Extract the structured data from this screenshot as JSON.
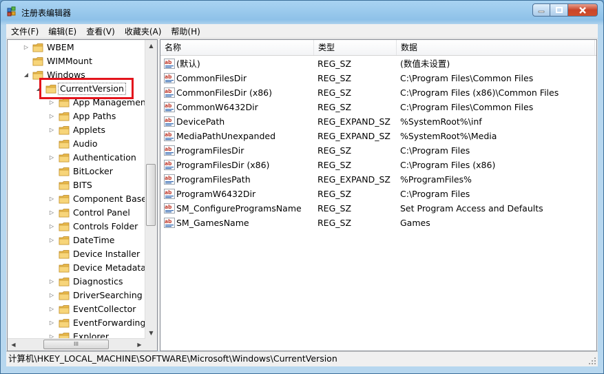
{
  "window": {
    "title": "注册表编辑器",
    "icon": "regedit-icon",
    "controls": {
      "minimize": "minimize-icon",
      "maximize": "maximize-icon",
      "close": "close-icon"
    }
  },
  "menu": [
    "文件(F)",
    "编辑(E)",
    "查看(V)",
    "收藏夹(A)",
    "帮助(H)"
  ],
  "tree": {
    "parents": [
      {
        "label": "WBEM",
        "expander": "collapsed"
      },
      {
        "label": "WIMMount",
        "expander": "none"
      },
      {
        "label": "Windows",
        "expander": "expanded"
      }
    ],
    "selected": {
      "label": "CurrentVersion",
      "expander": "expanded"
    },
    "children": [
      {
        "label": "App Management",
        "expander": "collapsed"
      },
      {
        "label": "App Paths",
        "expander": "collapsed"
      },
      {
        "label": "Applets",
        "expander": "collapsed"
      },
      {
        "label": "Audio",
        "expander": "none"
      },
      {
        "label": "Authentication",
        "expander": "collapsed"
      },
      {
        "label": "BitLocker",
        "expander": "none"
      },
      {
        "label": "BITS",
        "expander": "none"
      },
      {
        "label": "Component Based Servicing",
        "expander": "collapsed"
      },
      {
        "label": "Control Panel",
        "expander": "collapsed"
      },
      {
        "label": "Controls Folder",
        "expander": "collapsed"
      },
      {
        "label": "DateTime",
        "expander": "collapsed"
      },
      {
        "label": "Device Installer",
        "expander": "none"
      },
      {
        "label": "Device Metadata",
        "expander": "none"
      },
      {
        "label": "Diagnostics",
        "expander": "collapsed"
      },
      {
        "label": "DriverSearching",
        "expander": "collapsed"
      },
      {
        "label": "EventCollector",
        "expander": "collapsed"
      },
      {
        "label": "EventForwarding",
        "expander": "collapsed"
      },
      {
        "label": "Explorer",
        "expander": "collapsed"
      }
    ],
    "hscroll_grip": "III"
  },
  "list": {
    "columns": {
      "name": "名称",
      "type": "类型",
      "data": "数据"
    },
    "rows": [
      {
        "name": "(默认)",
        "type": "REG_SZ",
        "data": "(数值未设置)"
      },
      {
        "name": "CommonFilesDir",
        "type": "REG_SZ",
        "data": "C:\\Program Files\\Common Files"
      },
      {
        "name": "CommonFilesDir (x86)",
        "type": "REG_SZ",
        "data": "C:\\Program Files (x86)\\Common Files"
      },
      {
        "name": "CommonW6432Dir",
        "type": "REG_SZ",
        "data": "C:\\Program Files\\Common Files"
      },
      {
        "name": "DevicePath",
        "type": "REG_EXPAND_SZ",
        "data": "%SystemRoot%\\inf"
      },
      {
        "name": "MediaPathUnexpanded",
        "type": "REG_EXPAND_SZ",
        "data": "%SystemRoot%\\Media"
      },
      {
        "name": "ProgramFilesDir",
        "type": "REG_SZ",
        "data": "C:\\Program Files"
      },
      {
        "name": "ProgramFilesDir (x86)",
        "type": "REG_SZ",
        "data": "C:\\Program Files (x86)"
      },
      {
        "name": "ProgramFilesPath",
        "type": "REG_EXPAND_SZ",
        "data": "%ProgramFiles%"
      },
      {
        "name": "ProgramW6432Dir",
        "type": "REG_SZ",
        "data": "C:\\Program Files"
      },
      {
        "name": "SM_ConfigureProgramsName",
        "type": "REG_SZ",
        "data": "Set Program Access and Defaults"
      },
      {
        "name": "SM_GamesName",
        "type": "REG_SZ",
        "data": "Games"
      }
    ]
  },
  "status": {
    "path": "计算机\\HKEY_LOCAL_MACHINE\\SOFTWARE\\Microsoft\\Windows\\CurrentVersion"
  },
  "colors": {
    "highlight_box": "#e3141c",
    "folder": "#f2c94c",
    "titlebar": "#a9d3f2"
  }
}
